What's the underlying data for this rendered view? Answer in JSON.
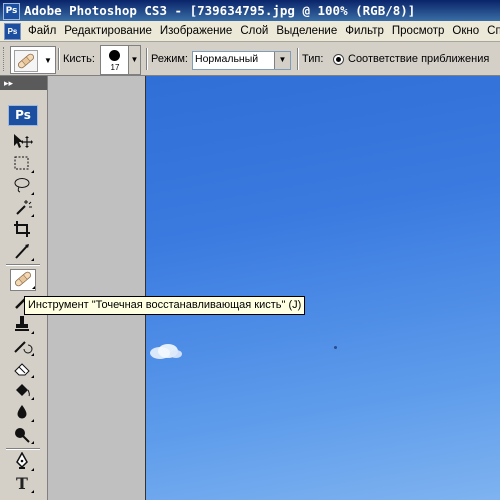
{
  "window": {
    "title": "Adobe Photoshop CS3 - [739634795.jpg @ 100% (RGB/8)]",
    "app_icon": "Ps"
  },
  "menu": {
    "items": [
      "Файл",
      "Редактирование",
      "Изображение",
      "Слой",
      "Выделение",
      "Фильтр",
      "Просмотр",
      "Окно",
      "Сп"
    ]
  },
  "options": {
    "brush_label": "Кисть:",
    "brush_size": "17",
    "mode_label": "Режим:",
    "mode_value": "Нормальный",
    "type_label": "Тип:",
    "type_option": "Соответствие приближения"
  },
  "toolbox": {
    "logo": "Ps",
    "tools": [
      {
        "name": "move-tool",
        "glyph": "▶✥"
      },
      {
        "name": "marquee-tool",
        "glyph": "⬚"
      },
      {
        "name": "lasso-tool",
        "glyph": "ʘ"
      },
      {
        "name": "magic-wand-tool",
        "glyph": "✳"
      },
      {
        "name": "crop-tool",
        "glyph": "⌗"
      },
      {
        "name": "slice-tool",
        "glyph": "✎"
      },
      {
        "name": "spot-healing-brush-tool",
        "glyph": "◪"
      },
      {
        "name": "brush-tool",
        "glyph": "✐"
      },
      {
        "name": "clone-stamp-tool",
        "glyph": "⚲"
      },
      {
        "name": "history-brush-tool",
        "glyph": "↺"
      },
      {
        "name": "eraser-tool",
        "glyph": "◇"
      },
      {
        "name": "paint-bucket-tool",
        "glyph": "◆"
      },
      {
        "name": "blur-tool",
        "glyph": "💧"
      },
      {
        "name": "dodge-tool",
        "glyph": "●"
      },
      {
        "name": "pen-tool",
        "glyph": "✒"
      },
      {
        "name": "type-tool",
        "glyph": "T"
      }
    ]
  },
  "tooltip": {
    "text": "Инструмент \"Точечная восстанавливающая кисть\" (J)"
  },
  "colors": {
    "title_bar": "#0a246a",
    "sky": "#3b7be0",
    "tooltip_bg": "#ffffe1"
  }
}
